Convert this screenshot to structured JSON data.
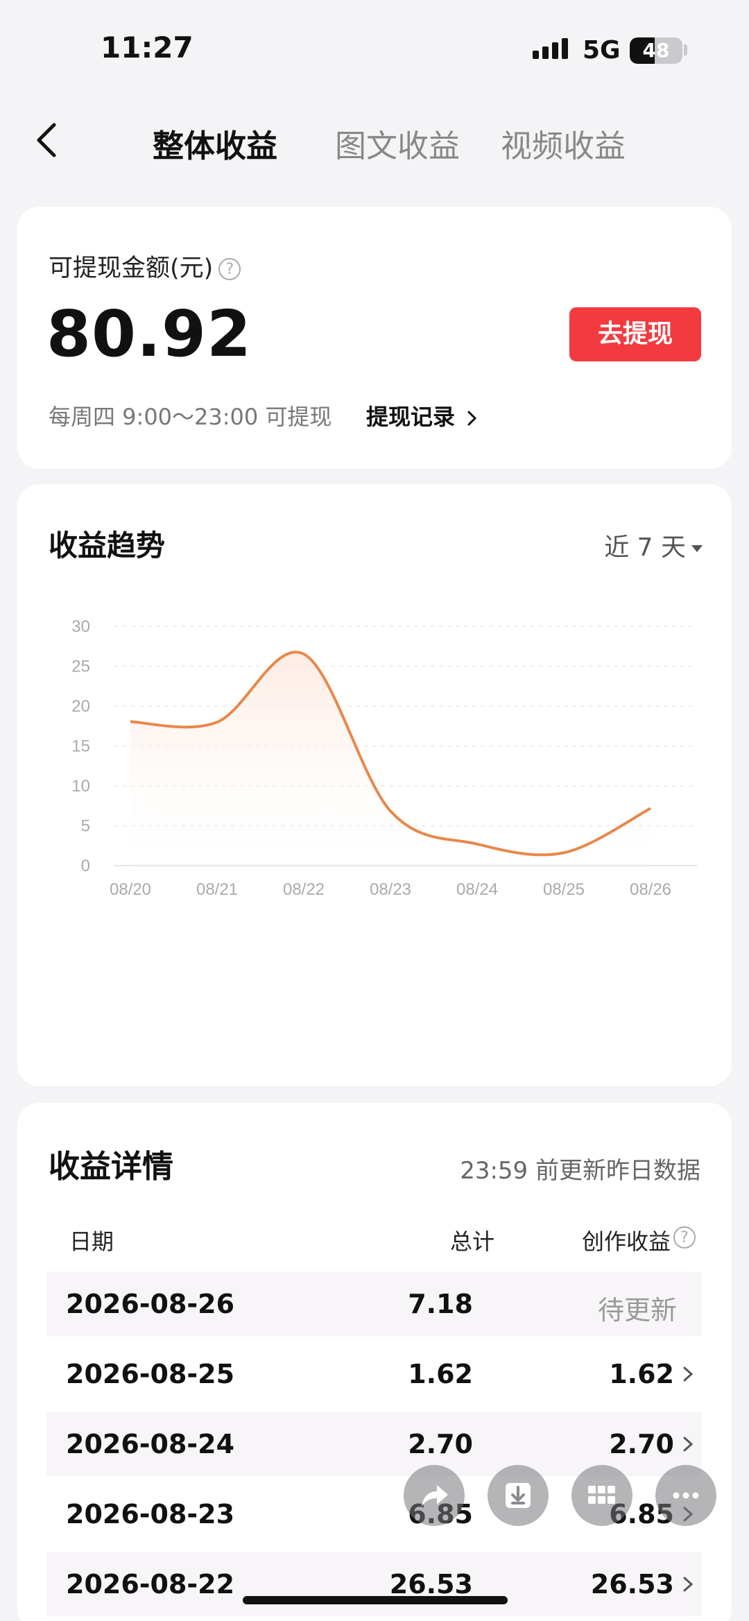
{
  "status": {
    "time": "11:27",
    "network": "5G",
    "battery": "48",
    "battery_level": 0.48
  },
  "tabs": [
    {
      "label": "整体收益"
    },
    {
      "label": "图文收益"
    },
    {
      "label": "视频收益"
    }
  ],
  "balance": {
    "label": "可提现金额(元)",
    "help": "?",
    "amount": "80.92",
    "button": "去提现",
    "note": "每周四 9:00～23:00 可提现",
    "record_link": "提现记录"
  },
  "trend": {
    "title": "收益趋势",
    "range": "近 7 天"
  },
  "chart_data": {
    "type": "area",
    "x": [
      "08/20",
      "08/21",
      "08/22",
      "08/23",
      "08/24",
      "08/25",
      "08/26"
    ],
    "series": [
      {
        "values": [
          18.04,
          17.99,
          26.53,
          6.85,
          2.7,
          1.62,
          7.18
        ]
      }
    ],
    "ylim": [
      0,
      30
    ],
    "yticks": [
      "0",
      "5",
      "10",
      "15",
      "20",
      "25",
      "30"
    ],
    "grid": true,
    "colors": {
      "line": "#e8884a",
      "fill_top": "#fde7dc",
      "fill_bottom": "#ffffff"
    }
  },
  "detail": {
    "title": "收益详情",
    "note": "23:59 前更新昨日数据",
    "headers": {
      "date": "日期",
      "total": "总计",
      "earn": "创作收益"
    },
    "help": "?",
    "rows": [
      {
        "date": "2026-08-26",
        "total": "7.18",
        "earn": "待更新"
      },
      {
        "date": "2026-08-25",
        "total": "1.62",
        "earn": "1.62"
      },
      {
        "date": "2026-08-24",
        "total": "2.70",
        "earn": "2.70"
      },
      {
        "date": "2026-08-23",
        "total": "6.85",
        "earn": "6.85"
      },
      {
        "date": "2026-08-22",
        "total": "26.53",
        "earn": "26.53"
      }
    ]
  },
  "floating_actions": [
    "share-icon",
    "download-icon",
    "grid-icon",
    "more-icon"
  ],
  "colors": {
    "accent": "#f23a3f",
    "line": "#e8884a"
  }
}
